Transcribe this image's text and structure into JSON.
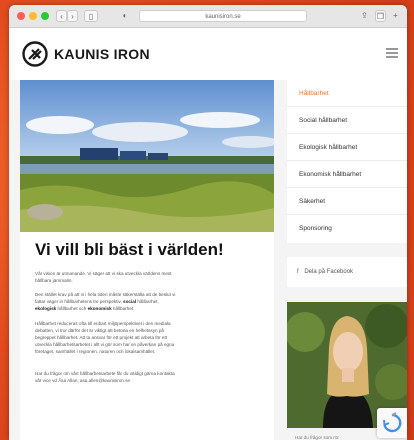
{
  "browser": {
    "url": "kaunisiron.se"
  },
  "header": {
    "logo_text": "KAUNIS IRON"
  },
  "content": {
    "heading": "Vi vill bli bäst i världen!",
    "para1_line1": "Vår vision är utmanande. Vi säger att vi ska utveckla världens mest",
    "para1_line2": "hållbara järnmalm.",
    "para2_line1": "Den stället krav på att vi i hela tiden måste säkerställa att de beslut vi",
    "para2_line2_pre": "fattar väger in hållbarhetens tre perspektiv, ",
    "para2_social": "social",
    "para2_line2_post": " hållbarhet,",
    "para2_ekologisk": "ekologisk",
    "para2_line3_mid": " hållbarhet och ",
    "para2_ekonomisk": "ekonomisk",
    "para2_line3_post": " hållbarhet.",
    "para3_line1": "Hållbarhet reduceras ofta till enbart miljöperspektivet i den mediala",
    "para3_line2": "debatten, vi tror därför det är viktigt att betona en helhetssyn på",
    "para3_line3": "begreppet hållbarhet. Att ta ansvar för ett projekt att arbeta för ett",
    "para3_line4": "utveckla hållbarhetsarbetet i allt vi gör som har en påverkan på egna",
    "para3_line5": "företaget, samhället i regionen, naturen och lokalsamhället.",
    "para4_line1": "Har du frågor om vårt hållbarhetsarbete får du väldigt gärna kontakta",
    "para4_line2": "vår vice vd Åsa Allan, asa.allen@kaunisiron.se"
  },
  "sidebar": {
    "nav": [
      {
        "label": "Hållbarhet",
        "active": true
      },
      {
        "label": "Social hållbarhet",
        "active": false
      },
      {
        "label": "Ekologisk hållbarhet",
        "active": false
      },
      {
        "label": "Ekonomisk hållbarhet",
        "active": false
      },
      {
        "label": "Säkerhet",
        "active": false
      },
      {
        "label": "Sponsoring",
        "active": false
      }
    ],
    "share_label": "Dela på Facebook",
    "caption": "Har du frågor som rör"
  },
  "colors": {
    "accent": "#e8782a",
    "background": "#e34a1f"
  }
}
